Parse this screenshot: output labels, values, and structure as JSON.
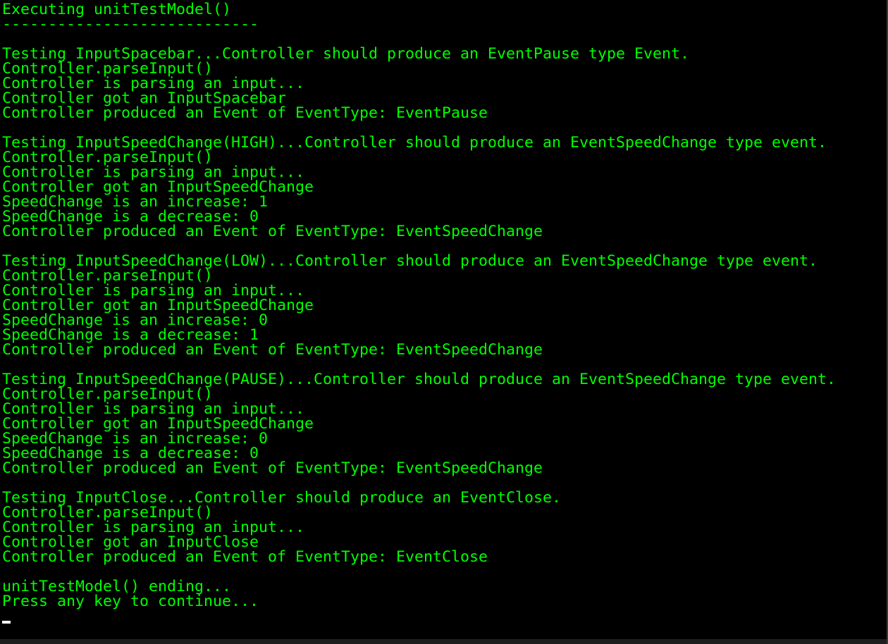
{
  "theme": {
    "background": "#000000",
    "text_color": "#00ff00",
    "cursor_color": "#ffffff"
  },
  "console": {
    "lines": [
      "Executing unitTestModel()",
      "----------------------------",
      "",
      "Testing InputSpacebar...Controller should produce an EventPause type Event.",
      "Controller.parseInput()",
      "Controller is parsing an input...",
      "Controller got an InputSpacebar",
      "Controller produced an Event of EventType: EventPause",
      "",
      "Testing InputSpeedChange(HIGH)...Controller should produce an EventSpeedChange type event.",
      "Controller.parseInput()",
      "Controller is parsing an input...",
      "Controller got an InputSpeedChange",
      "SpeedChange is an increase: 1",
      "SpeedChange is a decrease: 0",
      "Controller produced an Event of EventType: EventSpeedChange",
      "",
      "Testing InputSpeedChange(LOW)...Controller should produce an EventSpeedChange type event.",
      "Controller.parseInput()",
      "Controller is parsing an input...",
      "Controller got an InputSpeedChange",
      "SpeedChange is an increase: 0",
      "SpeedChange is a decrease: 1",
      "Controller produced an Event of EventType: EventSpeedChange",
      "",
      "Testing InputSpeedChange(PAUSE)...Controller should produce an EventSpeedChange type event.",
      "Controller.parseInput()",
      "Controller is parsing an input...",
      "Controller got an InputSpeedChange",
      "SpeedChange is an increase: 0",
      "SpeedChange is a decrease: 0",
      "Controller produced an Event of EventType: EventSpeedChange",
      "",
      "Testing InputClose...Controller should produce an EventClose.",
      "Controller.parseInput()",
      "Controller is parsing an input...",
      "Controller got an InputClose",
      "Controller produced an Event of EventType: EventClose",
      "",
      "unitTestModel() ending...",
      "Press any key to continue..."
    ]
  }
}
